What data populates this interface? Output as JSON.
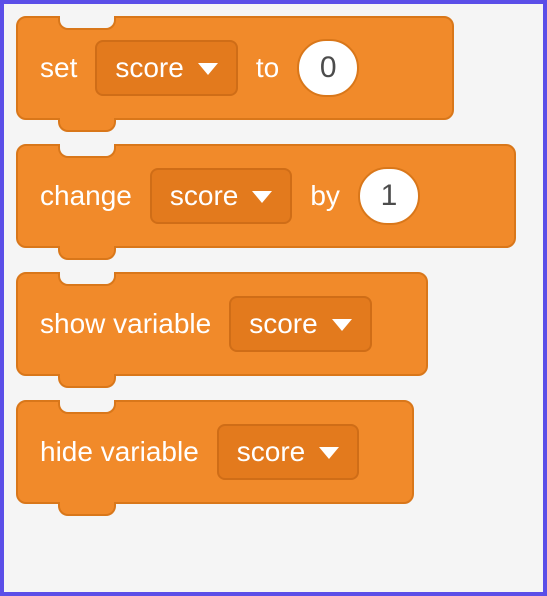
{
  "colors": {
    "block_fill": "#f18a2a",
    "block_border": "#d9771a",
    "dropdown_fill": "#e37a1d",
    "page_border": "#5b4ee8",
    "page_bg": "#f5f5f5"
  },
  "blocks": [
    {
      "id": "set-var",
      "parts": {
        "pre": "set",
        "var": "score",
        "mid": "to",
        "value": "0"
      }
    },
    {
      "id": "change-var",
      "parts": {
        "pre": "change",
        "var": "score",
        "mid": "by",
        "value": "1"
      }
    },
    {
      "id": "show-var",
      "parts": {
        "pre": "show variable",
        "var": "score"
      }
    },
    {
      "id": "hide-var",
      "parts": {
        "pre": "hide variable",
        "var": "score"
      }
    }
  ]
}
